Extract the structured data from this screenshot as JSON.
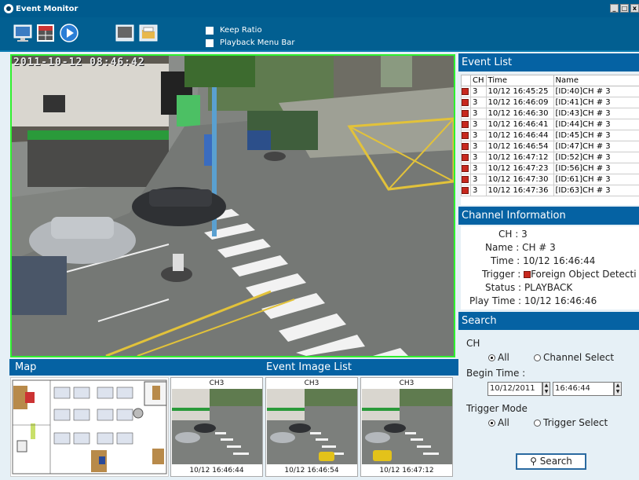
{
  "window": {
    "title": "Event Monitor"
  },
  "toolbar": {
    "icons": [
      "monitor-icon",
      "grid-icon",
      "play-icon",
      "screen-icon",
      "folder-icon"
    ],
    "keep_ratio_label": "Keep Ratio",
    "playback_menu_label": "Playback Menu Bar"
  },
  "video": {
    "timestamp": "2011-10-12  08:46:42"
  },
  "event_list": {
    "title": "Event List",
    "columns": [
      "",
      "CH",
      "Time",
      "Name"
    ],
    "rows": [
      {
        "ch": "3",
        "time": "10/12 16:45:25",
        "name": "[ID:40]CH # 3"
      },
      {
        "ch": "3",
        "time": "10/12 16:46:09",
        "name": "[ID:41]CH # 3"
      },
      {
        "ch": "3",
        "time": "10/12 16:46:30",
        "name": "[ID:43]CH # 3"
      },
      {
        "ch": "3",
        "time": "10/12 16:46:41",
        "name": "[ID:44]CH # 3"
      },
      {
        "ch": "3",
        "time": "10/12 16:46:44",
        "name": "[ID:45]CH # 3"
      },
      {
        "ch": "3",
        "time": "10/12 16:46:54",
        "name": "[ID:47]CH # 3"
      },
      {
        "ch": "3",
        "time": "10/12 16:47:12",
        "name": "[ID:52]CH # 3"
      },
      {
        "ch": "3",
        "time": "10/12 16:47:23",
        "name": "[ID:56]CH # 3"
      },
      {
        "ch": "3",
        "time": "10/12 16:47:30",
        "name": "[ID:61]CH # 3"
      },
      {
        "ch": "3",
        "time": "10/12 16:47:36",
        "name": "[ID:63]CH # 3"
      }
    ]
  },
  "channel_info": {
    "title": "Channel Information",
    "ch_label": "CH :",
    "ch": "3",
    "name_label": "Name :",
    "name": "CH # 3",
    "time_label": "Time :",
    "time": "10/12 16:46:44",
    "trigger_label": "Trigger :",
    "trigger": "Foreign Object Detecti",
    "status_label": "Status :",
    "status": "PLAYBACK",
    "playtime_label": "Play Time :",
    "playtime": "10/12 16:46:46"
  },
  "search": {
    "title": "Search",
    "ch_label": "CH",
    "ch_all": "All",
    "ch_select": "Channel Select",
    "begin_label": "Begin Time :",
    "begin_date": "10/12/2011",
    "begin_time": "16:46:44",
    "trigger_label": "Trigger Mode",
    "trigger_all": "All",
    "trigger_select": "Trigger Select",
    "button": "Search"
  },
  "map": {
    "title": "Map"
  },
  "event_images": {
    "title": "Event Image List",
    "items": [
      {
        "channel": "CH3",
        "time": "10/12 16:46:44"
      },
      {
        "channel": "CH3",
        "time": "10/12 16:46:54"
      },
      {
        "channel": "CH3",
        "time": "10/12 16:47:12"
      }
    ]
  }
}
